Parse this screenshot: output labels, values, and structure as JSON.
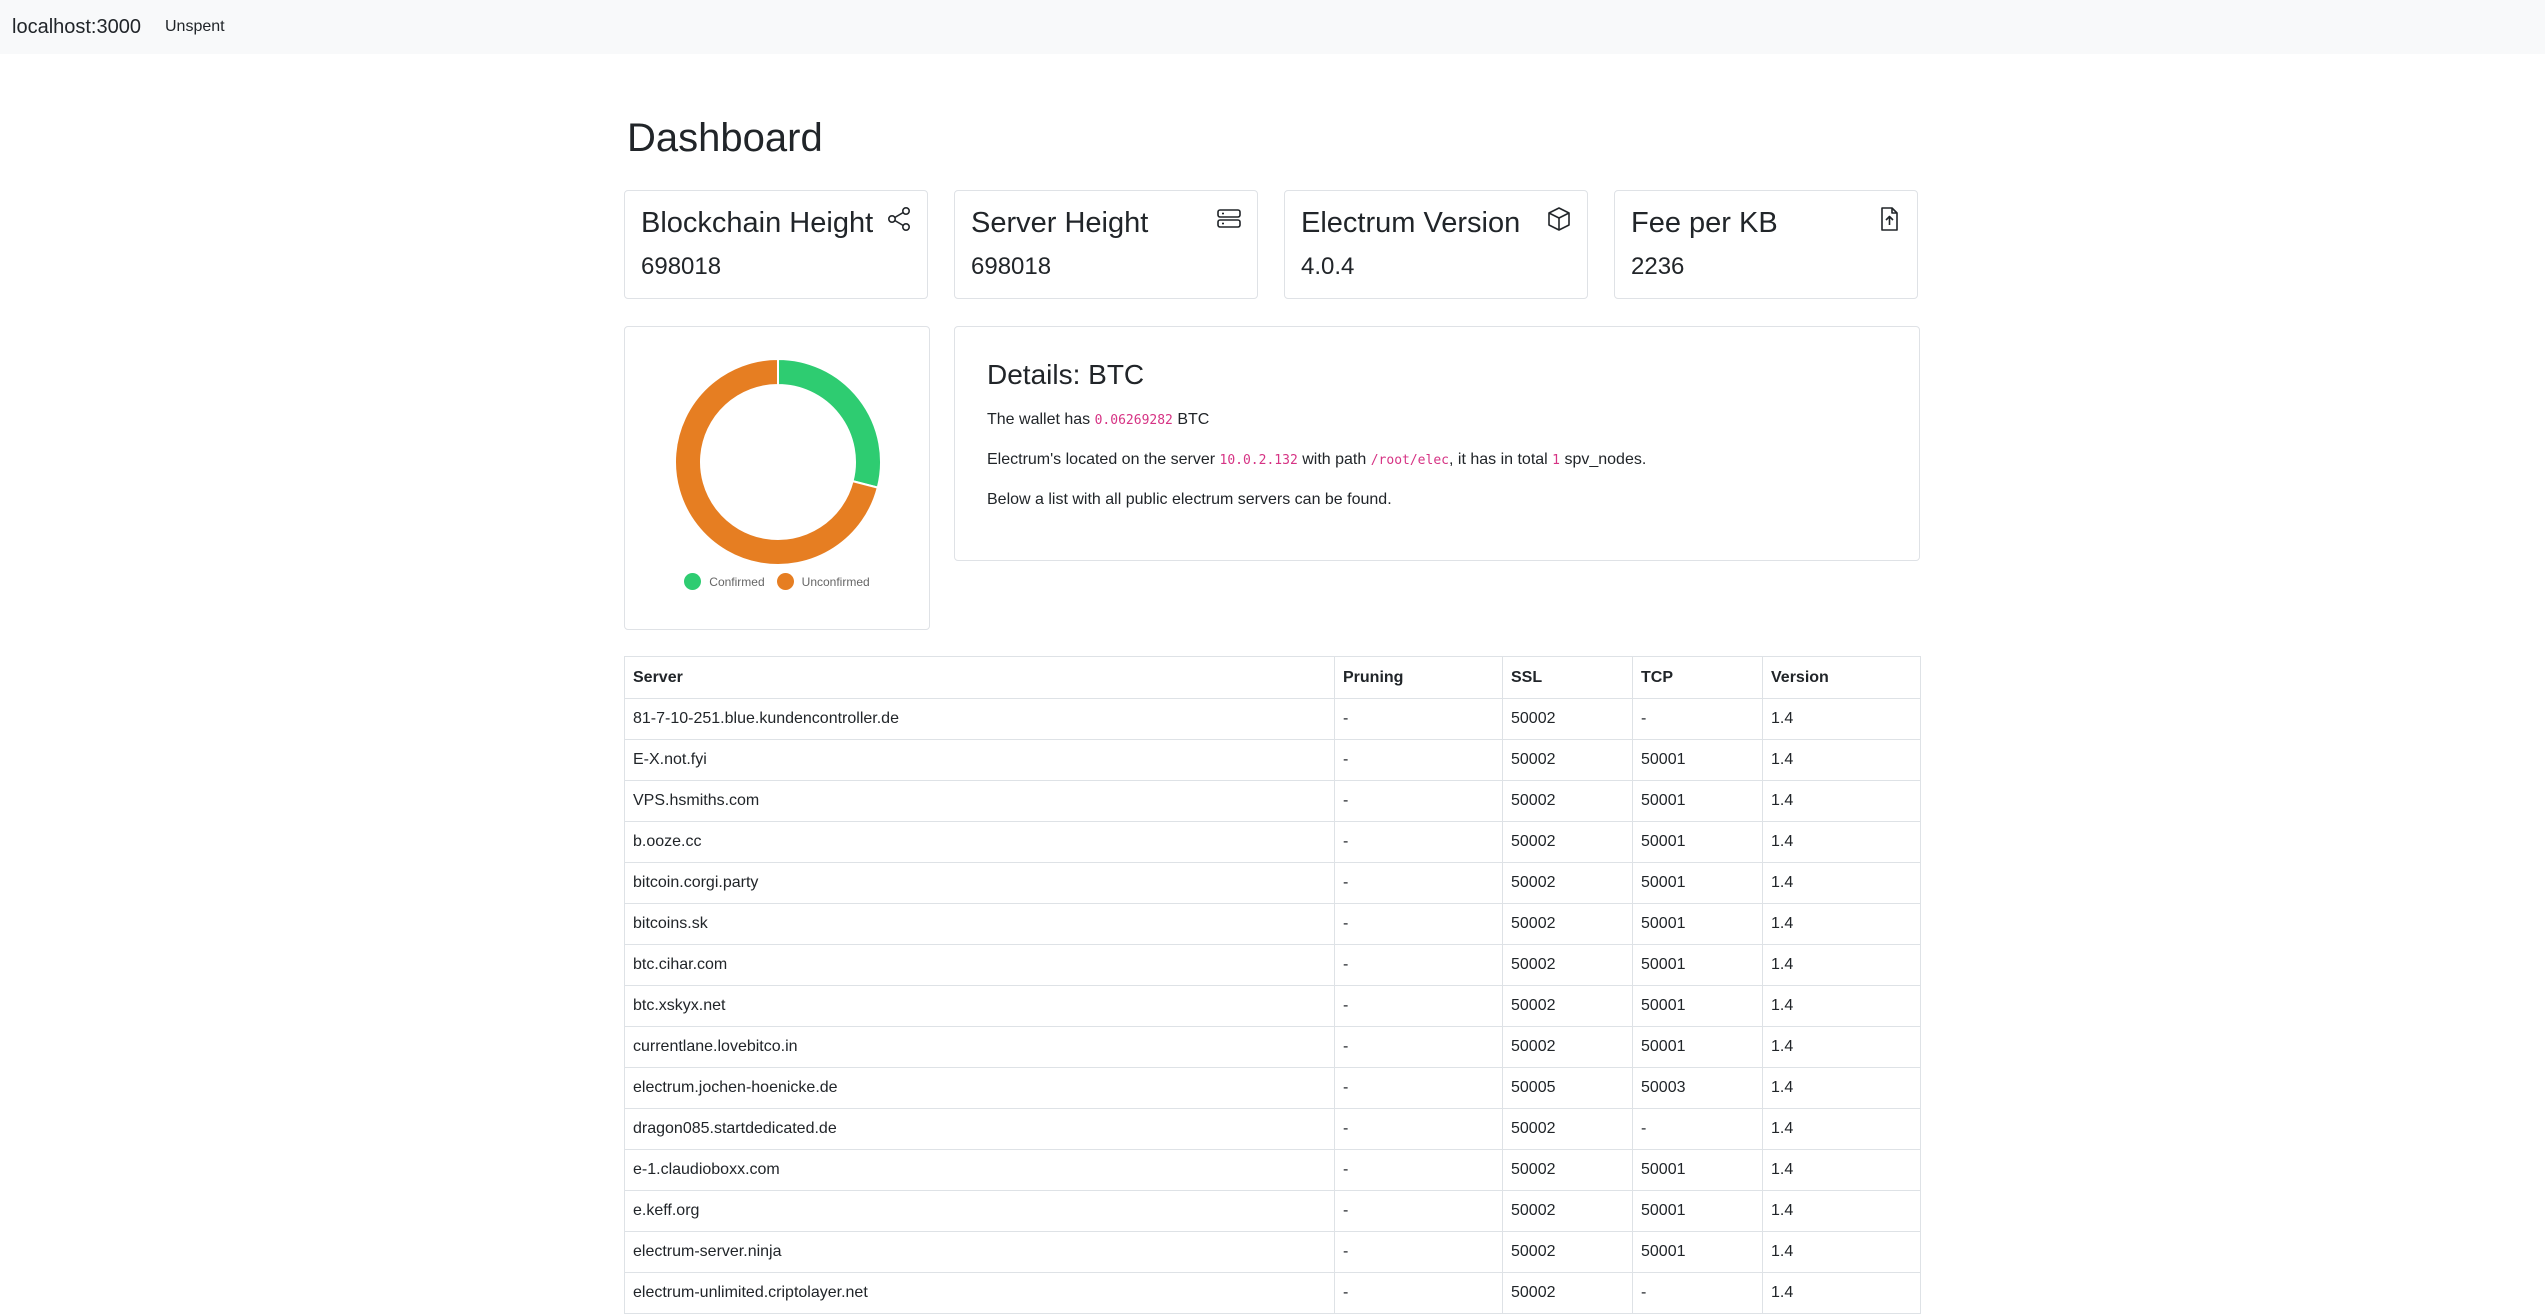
{
  "navbar": {
    "brand": "localhost:3000",
    "links": [
      "Unspent"
    ]
  },
  "page": {
    "title": "Dashboard"
  },
  "stats": [
    {
      "title": "Blockchain Height",
      "value": "698018",
      "icon": "share-icon"
    },
    {
      "title": "Server Height",
      "value": "698018",
      "icon": "server-icon"
    },
    {
      "title": "Electrum Version",
      "value": "4.0.4",
      "icon": "box-icon"
    },
    {
      "title": "Fee per KB",
      "value": "2236",
      "icon": "file-upload-icon"
    }
  ],
  "chart_data": {
    "type": "pie",
    "variant": "doughnut",
    "categories": [
      "Confirmed",
      "Unconfirmed"
    ],
    "values": [
      29,
      71
    ],
    "colors": [
      "#2ecc71",
      "#e67e22"
    ],
    "legend": "bottom"
  },
  "details": {
    "title": "Details: BTC",
    "line1_prefix": "The wallet has ",
    "balance": "0.06269282",
    "line1_suffix": " BTC",
    "line2_a": "Electrum's located on the server ",
    "server_ip": "10.0.2.132",
    "line2_b": " with path ",
    "server_path": "/root/elec",
    "line2_c": ", it has in total ",
    "node_count": "1",
    "line2_d": " spv_nodes.",
    "line3": "Below a list with all public electrum servers can be found."
  },
  "servers_table": {
    "columns": [
      "Server",
      "Pruning",
      "SSL",
      "TCP",
      "Version"
    ],
    "rows": [
      [
        "81-7-10-251.blue.kundencontroller.de",
        "-",
        "50002",
        "-",
        "1.4"
      ],
      [
        "E-X.not.fyi",
        "-",
        "50002",
        "50001",
        "1.4"
      ],
      [
        "VPS.hsmiths.com",
        "-",
        "50002",
        "50001",
        "1.4"
      ],
      [
        "b.ooze.cc",
        "-",
        "50002",
        "50001",
        "1.4"
      ],
      [
        "bitcoin.corgi.party",
        "-",
        "50002",
        "50001",
        "1.4"
      ],
      [
        "bitcoins.sk",
        "-",
        "50002",
        "50001",
        "1.4"
      ],
      [
        "btc.cihar.com",
        "-",
        "50002",
        "50001",
        "1.4"
      ],
      [
        "btc.xskyx.net",
        "-",
        "50002",
        "50001",
        "1.4"
      ],
      [
        "currentlane.lovebitco.in",
        "-",
        "50002",
        "50001",
        "1.4"
      ],
      [
        "electrum.jochen-hoenicke.de",
        "-",
        "50005",
        "50003",
        "1.4"
      ],
      [
        "dragon085.startdedicated.de",
        "-",
        "50002",
        "-",
        "1.4"
      ],
      [
        "e-1.claudioboxx.com",
        "-",
        "50002",
        "50001",
        "1.4"
      ],
      [
        "e.keff.org",
        "-",
        "50002",
        "50001",
        "1.4"
      ],
      [
        "electrum-server.ninja",
        "-",
        "50002",
        "50001",
        "1.4"
      ],
      [
        "electrum-unlimited.criptolayer.net",
        "-",
        "50002",
        "-",
        "1.4"
      ]
    ]
  }
}
